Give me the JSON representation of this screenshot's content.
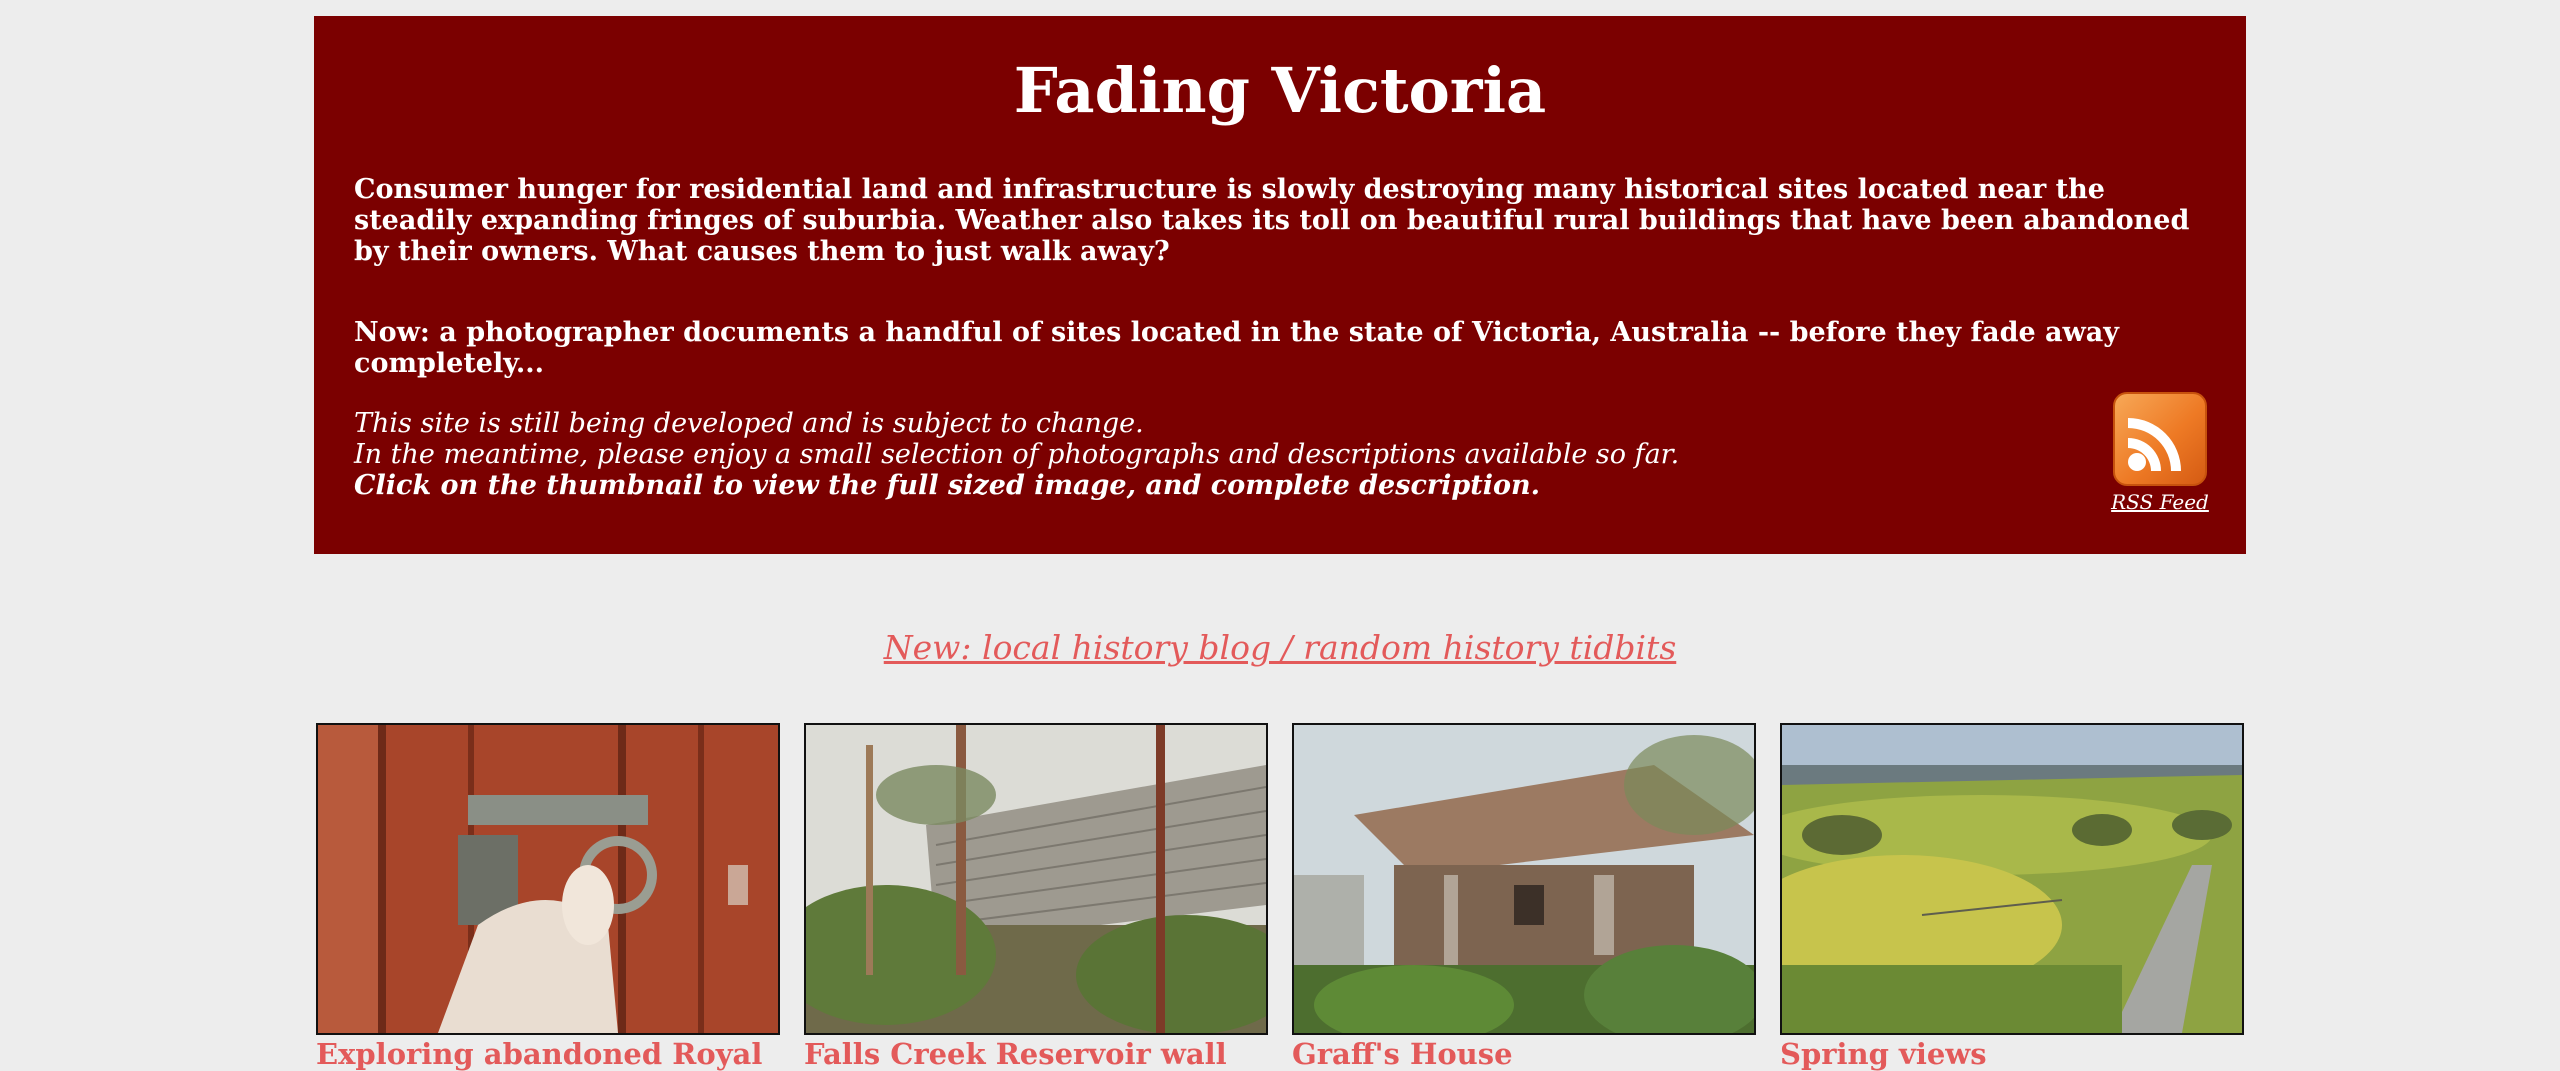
{
  "site": {
    "title": "Fading Victoria",
    "intro": "Consumer hunger for residential land and infrastructure is slowly destroying many historical sites located near the steadily expanding fringes of suburbia. Weather also takes its toll on beautiful rural buildings that have been abandoned by their owners. What causes them to just walk away?",
    "now": "Now: a photographer documents a handful of sites located in the state of Victoria, Australia -- before they fade away completely...",
    "notes": {
      "line1": "This site is still being developed and is subject to change.",
      "line2": "In the meantime, please enjoy a small selection of photographs and descriptions available so far.",
      "line3": "Click on the thumbnail to view the full sized image, and complete description."
    },
    "rss_label": "RSS Feed",
    "rss_icon": "rss-icon"
  },
  "blog_link": "New: local history blog / random history tidbits",
  "gallery": [
    {
      "caption": "Exploring abandoned Royal"
    },
    {
      "caption": "Falls Creek Reservoir wall"
    },
    {
      "caption": "Graff's House"
    },
    {
      "caption": "Spring views"
    }
  ],
  "colors": {
    "background": "#ededed",
    "banner": "#7b0000",
    "link": "#e35a5a",
    "rss": "#ee7a25"
  }
}
